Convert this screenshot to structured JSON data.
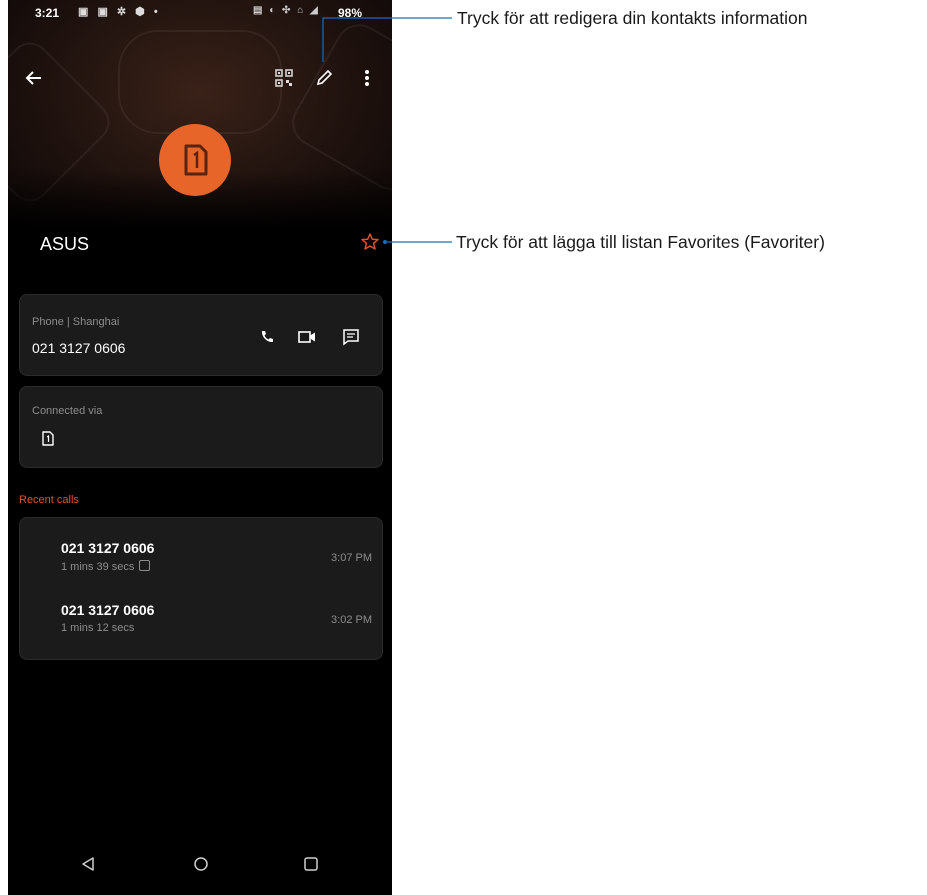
{
  "status_bar": {
    "time": "3:21",
    "battery": "98%"
  },
  "contact": {
    "name": "ASUS"
  },
  "phone_card": {
    "label": "Phone | Shanghai",
    "number": "021 3127 0606"
  },
  "connected_card": {
    "label": "Connected via"
  },
  "recent_calls": {
    "title": "Recent calls",
    "items": [
      {
        "number": "021 3127 0606",
        "duration": "1 mins 39 secs",
        "time": "3:07 PM"
      },
      {
        "number": "021 3127 0606",
        "duration": "1 mins 12 secs",
        "time": "3:02 PM"
      }
    ]
  },
  "annotations": {
    "edit": "Tryck för att redigera din kontakts information",
    "favorite": "Tryck för att lägga till listan Favorites (Favoriter)"
  },
  "colors": {
    "accent": "#e8652a",
    "star": "#e0522b",
    "callout_line": "#1a6bb8"
  },
  "icons": [
    "back-arrow-icon",
    "qr-code-icon",
    "edit-pencil-icon",
    "more-vert-icon",
    "sim-card-icon",
    "star-outline-icon",
    "phone-icon",
    "video-icon",
    "message-icon",
    "back-nav-icon",
    "home-nav-icon",
    "recents-nav-icon"
  ]
}
